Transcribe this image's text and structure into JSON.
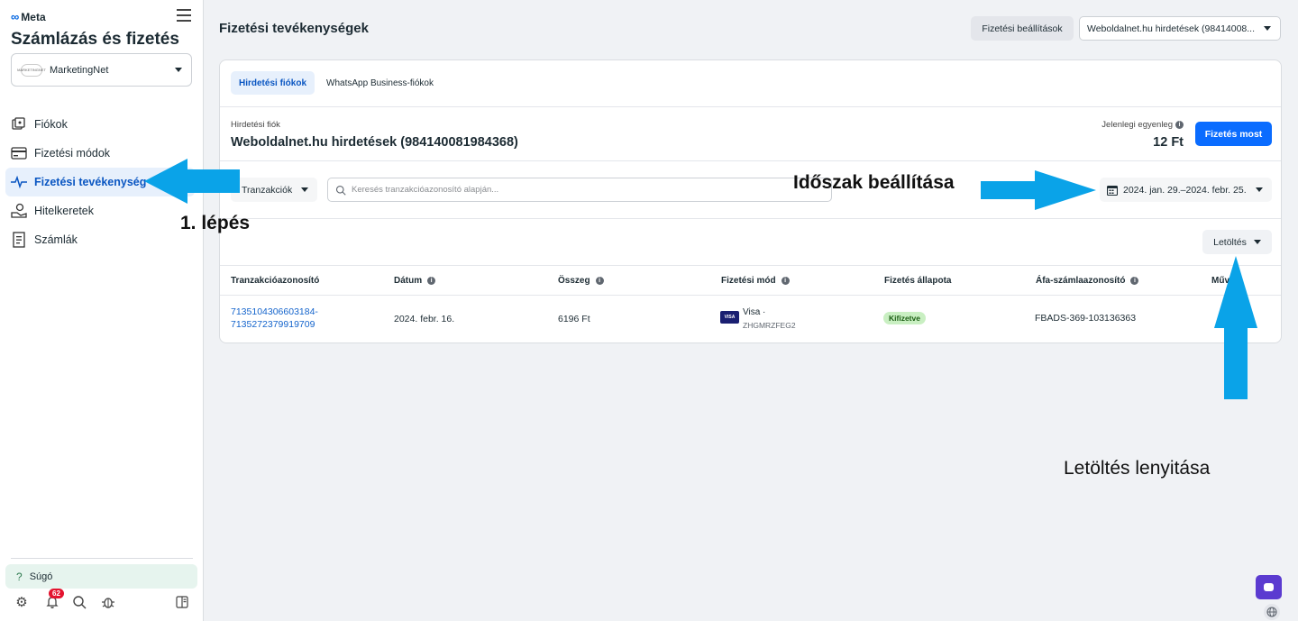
{
  "sidebar": {
    "brand": "Meta",
    "title": "Számlázás és fizetés",
    "account": {
      "logo_text": "MARKETINGNET",
      "name": "MarketingNet"
    },
    "items": [
      {
        "label": "Fiókok",
        "icon": "accounts-icon",
        "active": false
      },
      {
        "label": "Fizetési módok",
        "icon": "card-icon",
        "active": false
      },
      {
        "label": "Fizetési tevékenység",
        "icon": "activity-icon",
        "active": true
      },
      {
        "label": "Hitelkeretek",
        "icon": "credit-icon",
        "active": false
      },
      {
        "label": "Számlák",
        "icon": "invoice-icon",
        "active": false
      }
    ],
    "help": "Súgó",
    "notification_count": "62"
  },
  "header": {
    "title": "Fizetési tevékenységek",
    "settings_label": "Fizetési beállítások",
    "account_dropdown": "Weboldalnet.hu hirdetések (98414008..."
  },
  "tabs": [
    {
      "label": "Hirdetési fiókok",
      "active": true
    },
    {
      "label": "WhatsApp Business-fiókok",
      "active": false
    }
  ],
  "account_info": {
    "label": "Hirdetési fiók",
    "value": "Weboldalnet.hu hirdetések (984140081984368)",
    "balance_label": "Jelenlegi egyenleg",
    "balance_value": "12 Ft",
    "pay_label": "Fizetés most"
  },
  "filters": {
    "type_label": "Tranzakciók",
    "search_placeholder": "Keresés tranzakcióazonosító alapján...",
    "date_range": "2024. jan. 29.–2024. febr. 25.",
    "download_label": "Letöltés"
  },
  "table": {
    "headers": [
      "Tranzakcióazonosító",
      "Dátum",
      "Összeg",
      "Fizetési mód",
      "Fizetés állapota",
      "Áfa-számlaazonosító",
      "Műv"
    ],
    "rows": [
      {
        "id_line1": "7135104306603184-",
        "id_line2": "7135272379919709",
        "date": "2024. febr. 16.",
        "amount": "6196 Ft",
        "method_logo": "VISA",
        "method_name": "Visa ·",
        "method_code": "ZHGMRZFEG2",
        "status": "Kifizetve",
        "invoice": "FBADS-369-103136363"
      }
    ]
  },
  "annotations": {
    "step": "1. lépés",
    "time": "Időszak beállítása",
    "download": "Letöltés lenyitása"
  },
  "colors": {
    "accent": "#0a6cff",
    "annotation_arrow": "#0aa3e8",
    "active_nav": "#e7f0fc"
  }
}
